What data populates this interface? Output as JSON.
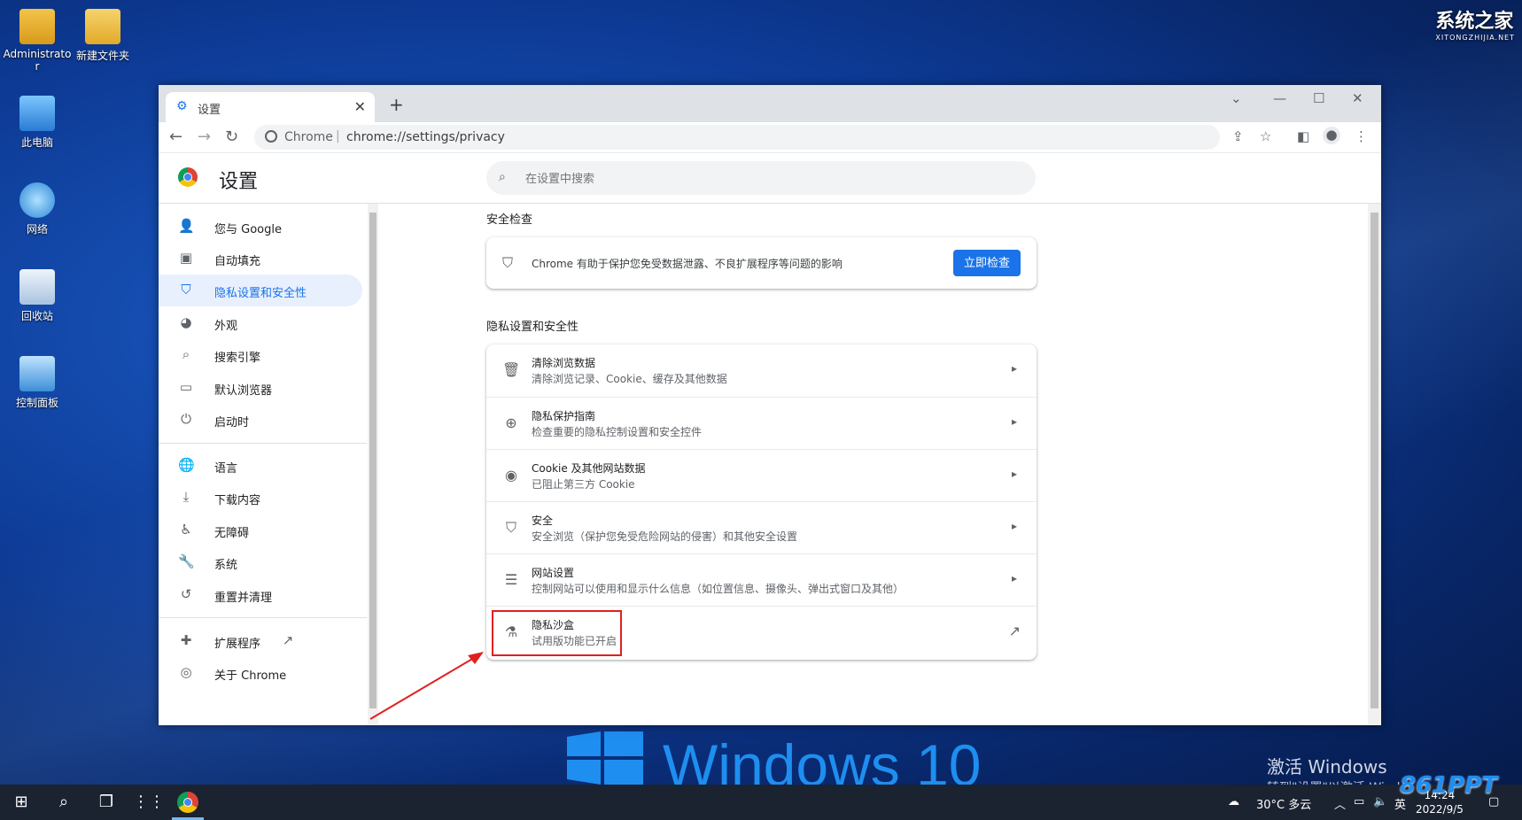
{
  "desktop": {
    "icons": [
      {
        "label": "Administrato r"
      },
      {
        "label": "新建文件夹"
      },
      {
        "label": "此电脑"
      },
      {
        "label": "网络"
      },
      {
        "label": "回收站"
      },
      {
        "label": "控制面板"
      }
    ],
    "watermark": {
      "brand": "系统之家",
      "sub": "XITONGZHIJIA.NET"
    },
    "wallpaper_text": "Windows 10",
    "activation": {
      "line1": "激活 Windows",
      "line2": "转到\"设置\"以激活 Windows。"
    },
    "corner_watermark": "861PPT"
  },
  "browser": {
    "tab_title": "设置",
    "omnibox": {
      "host": "Chrome",
      "url": "chrome://settings/privacy"
    },
    "settings_title": "设置",
    "search_placeholder": "在设置中搜索"
  },
  "sidebar": {
    "items": [
      {
        "label": "您与 Google",
        "icon": "person-icon"
      },
      {
        "label": "自动填充",
        "icon": "clipboard-icon"
      },
      {
        "label": "隐私设置和安全性",
        "icon": "shield-icon",
        "active": true
      },
      {
        "label": "外观",
        "icon": "palette-icon"
      },
      {
        "label": "搜索引擎",
        "icon": "search-icon"
      },
      {
        "label": "默认浏览器",
        "icon": "browser-icon"
      },
      {
        "label": "启动时",
        "icon": "power-icon"
      },
      {
        "label": "语言",
        "icon": "globe-icon"
      },
      {
        "label": "下载内容",
        "icon": "download-icon"
      },
      {
        "label": "无障碍",
        "icon": "accessibility-icon"
      },
      {
        "label": "系统",
        "icon": "wrench-icon"
      },
      {
        "label": "重置并清理",
        "icon": "history-icon"
      },
      {
        "label": "扩展程序",
        "icon": "puzzle-icon"
      },
      {
        "label": "关于 Chrome",
        "icon": "chrome-icon"
      }
    ]
  },
  "main": {
    "safety_check": {
      "title": "安全检查",
      "text": "Chrome 有助于保护您免受数据泄露、不良扩展程序等问题的影响",
      "button": "立即检查"
    },
    "privacy_section": {
      "title": "隐私设置和安全性",
      "rows": [
        {
          "title": "清除浏览数据",
          "subtitle": "清除浏览记录、Cookie、缓存及其他数据",
          "icon": "trash-icon"
        },
        {
          "title": "隐私保护指南",
          "subtitle": "检查重要的隐私控制设置和安全控件",
          "icon": "guide-icon"
        },
        {
          "title": "Cookie 及其他网站数据",
          "subtitle": "已阻止第三方 Cookie",
          "icon": "cookie-icon"
        },
        {
          "title": "安全",
          "subtitle": "安全浏览（保护您免受危险网站的侵害）和其他安全设置",
          "icon": "shield-icon"
        },
        {
          "title": "网站设置",
          "subtitle": "控制网站可以使用和显示什么信息（如位置信息、摄像头、弹出式窗口及其他）",
          "icon": "sliders-icon"
        },
        {
          "title": "隐私沙盒",
          "subtitle": "试用版功能已开启",
          "icon": "flask-icon"
        }
      ]
    }
  },
  "taskbar": {
    "weather": "30°C 多云",
    "ime": "英",
    "time": "14:24",
    "date": "2022/9/5"
  },
  "colors": {
    "accent": "#1a73e8",
    "highlight": "#e02020"
  }
}
